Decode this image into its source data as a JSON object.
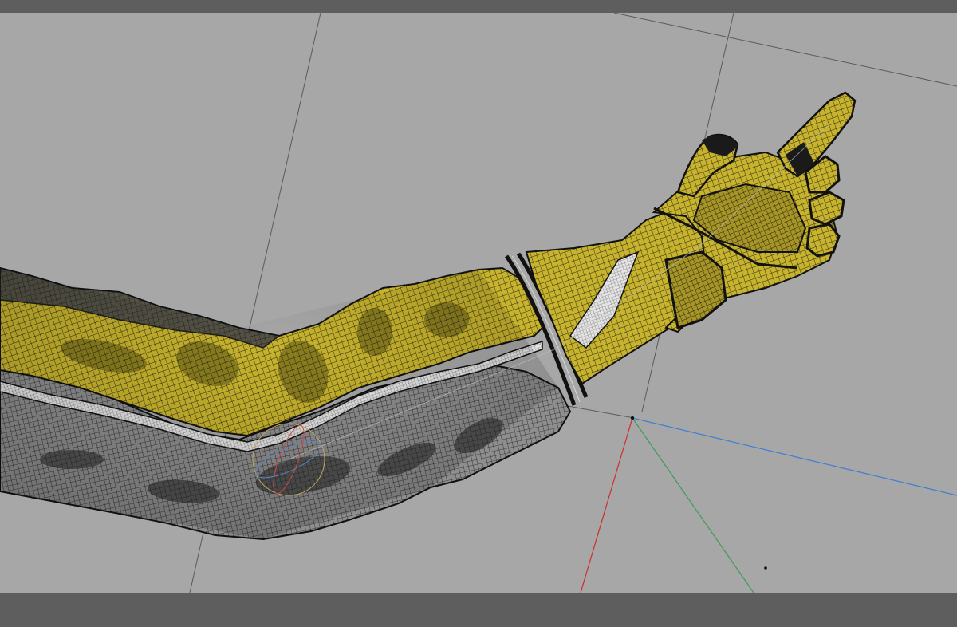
{
  "viewport": {
    "background": "#a7a7a7",
    "bars_color": "#5e5e5e",
    "grid_line_color": "#5a5a5a",
    "axes": {
      "x_axis_color": "#d12b2b",
      "y_axis_color": "#3f9a5a",
      "z_axis_color": "#3d7fd6"
    },
    "mesh": {
      "name": "arm-mesh",
      "glove_color": "#c9b52e",
      "sleeve_yellow_color": "#b8a52a",
      "sleeve_grey_color": "#8a8a8a",
      "wire_color": "#1a1a1a",
      "piping_color": "#e6e6e6"
    },
    "gizmo": "rotation-gizmo"
  }
}
